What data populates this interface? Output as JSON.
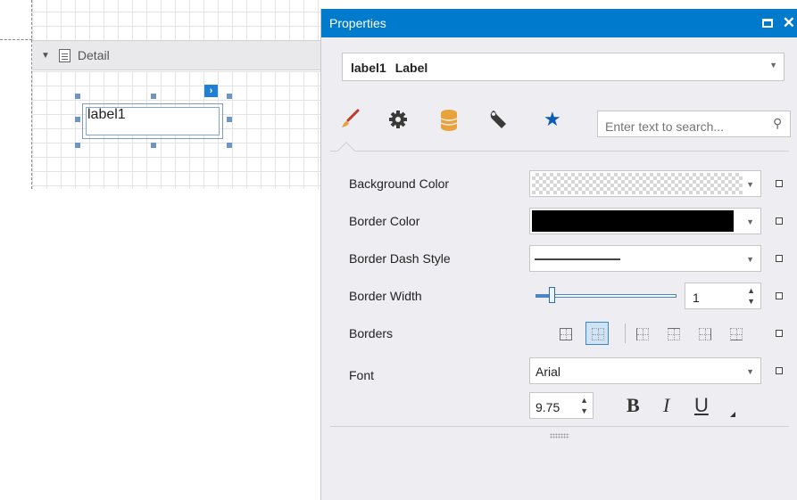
{
  "designer": {
    "band_label": "Detail",
    "control_text": "label1"
  },
  "panel": {
    "title": "Properties",
    "object_name": "label1",
    "object_class": "Label",
    "tabs": [
      {
        "name": "appearance",
        "icon": "paintbrush-icon",
        "color": "#c0392b"
      },
      {
        "name": "behavior",
        "icon": "gear-icon",
        "color": "#3a3a3a"
      },
      {
        "name": "data",
        "icon": "database-icon",
        "color": "#e8a33d"
      },
      {
        "name": "design",
        "icon": "wrench-icon",
        "color": "#3a3a3a"
      },
      {
        "name": "favorites",
        "icon": "star-icon",
        "color": "#0a5cb4"
      }
    ],
    "search_placeholder": "Enter text to search..."
  },
  "properties": {
    "background_color": {
      "label": "Background Color"
    },
    "border_color": {
      "label": "Border Color",
      "value": "#000000"
    },
    "border_dash_style": {
      "label": "Border Dash Style"
    },
    "border_width": {
      "label": "Border Width",
      "value": "1"
    },
    "borders": {
      "label": "Borders"
    },
    "font": {
      "label": "Font",
      "family": "Arial",
      "size": "9.75",
      "bold": "B",
      "italic": "I",
      "underline": "U"
    }
  },
  "colors": {
    "titlebar": "#007acc",
    "panel_bg": "#eeeef2",
    "selection": "#cfe3f7"
  }
}
